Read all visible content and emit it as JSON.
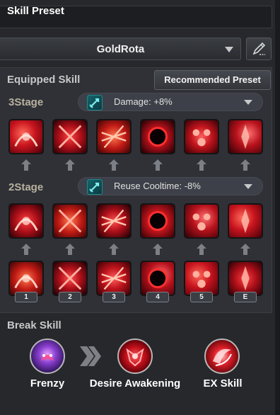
{
  "header": {
    "title": "Skill Preset"
  },
  "preset": {
    "name": "GoldRota",
    "edit_icon": "pencil-icon"
  },
  "equipped": {
    "label": "Equipped Skill",
    "recommended_label": "Recommended Preset",
    "stages": [
      {
        "label": "3Stage",
        "effect": "Damage: +8%",
        "effect_icon": "sword-up-icon"
      },
      {
        "label": "2Stage",
        "effect": "Reuse Cooltime: -8%",
        "effect_icon": "sword-up-icon"
      }
    ],
    "slots": [
      "1",
      "2",
      "3",
      "4",
      "5",
      "E"
    ]
  },
  "break": {
    "label": "Break Skill",
    "skills": [
      {
        "name": "Frenzy",
        "color": "#6a3fb0"
      },
      {
        "name": "Desire Awakening",
        "color": "#b0141e"
      },
      {
        "name": "EX Skill",
        "color": "#c81c2a"
      }
    ]
  },
  "colors": {
    "accent_red": "#d01420",
    "panel": "#2f3136",
    "teal_icon": "#12656b"
  }
}
